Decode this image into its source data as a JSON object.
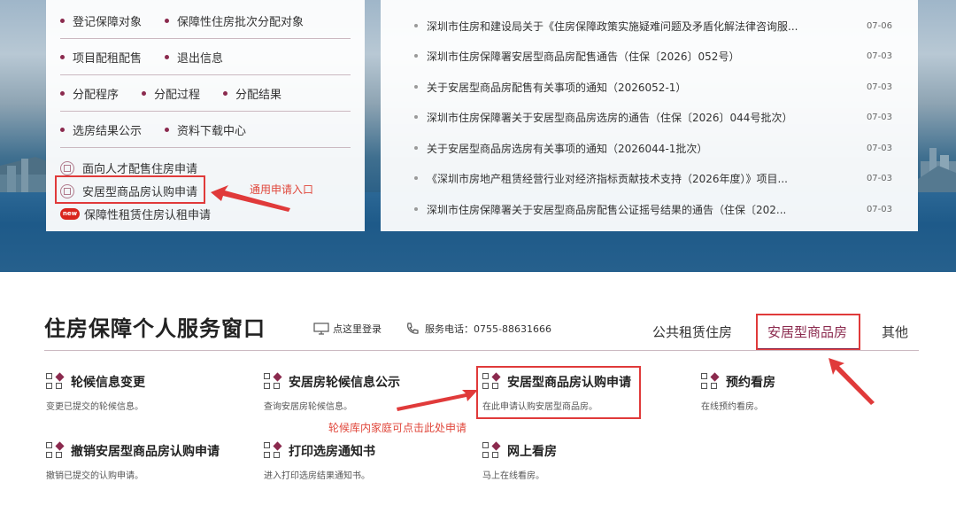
{
  "left_menu": {
    "rows": [
      [
        "登记保障对象",
        "保障性住房批次分配对象"
      ],
      [
        "项目配租配售",
        "退出信息"
      ],
      [
        "分配程序",
        "分配过程",
        "分配结果"
      ],
      [
        "选房结果公示",
        "资料下载中心"
      ]
    ],
    "apply_links": [
      "面向人才配售住房申请",
      "安居型商品房认购申请",
      "保障性租赁住房认租申请"
    ],
    "new_badge": "new",
    "annotation": "通用申请入口"
  },
  "news": [
    {
      "title": "深圳市住房和建设局关于《住房保障政策实施疑难问题及矛盾化解法律咨询服...",
      "date": "07-06"
    },
    {
      "title": "深圳市住房保障署安居型商品房配售通告（住保〔2026〕052号）",
      "date": "07-03"
    },
    {
      "title": "关于安居型商品房配售有关事项的通知（2026052-1）",
      "date": "07-03"
    },
    {
      "title": "深圳市住房保障署关于安居型商品房选房的通告（住保〔2026〕044号批次）",
      "date": "07-03"
    },
    {
      "title": "关于安居型商品房选房有关事项的通知（2026044-1批次）",
      "date": "07-03"
    },
    {
      "title": "《深圳市房地产租赁经营行业对经济指标贡献技术支持（2026年度）》项目...",
      "date": "07-03"
    },
    {
      "title": "深圳市住房保障署关于安居型商品房配售公证摇号结果的通告（住保〔202...",
      "date": "07-03"
    }
  ],
  "service": {
    "title": "住房保障个人服务窗口",
    "login": "点这里登录",
    "phone": "服务电话：0755-88631666",
    "tabs": [
      "公共租赁住房",
      "安居型商品房",
      "其他"
    ],
    "items": [
      {
        "title": "轮候信息变更",
        "desc": "变更已提交的轮候信息。"
      },
      {
        "title": "安居房轮候信息公示",
        "desc": "查询安居房轮候信息。"
      },
      {
        "title": "安居型商品房认购申请",
        "desc": "在此申请认购安居型商品房。"
      },
      {
        "title": "预约看房",
        "desc": "在线预约看房。"
      },
      {
        "title": "撤销安居型商品房认购申请",
        "desc": "撤销已提交的认购申请。"
      },
      {
        "title": "打印选房通知书",
        "desc": "进入打印选房结果通知书。"
      },
      {
        "title": "网上看房",
        "desc": "马上在线看房。"
      }
    ],
    "annotation": "轮候库内家庭可点击此处申请"
  },
  "colors": {
    "accent": "#8b2a4e",
    "annotation": "#e03a3a"
  }
}
